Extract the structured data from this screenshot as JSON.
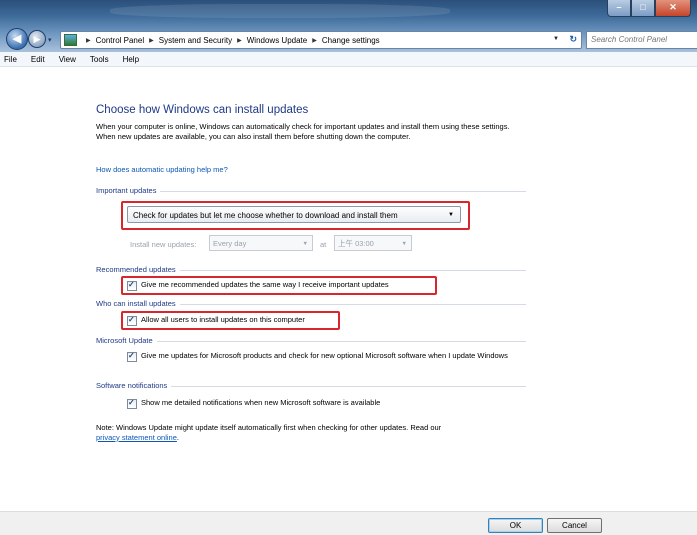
{
  "window": {
    "address_crumbs": [
      "Control Panel",
      "System and Security",
      "Windows Update",
      "Change settings"
    ],
    "search_placeholder": "Search Control Panel",
    "menu": [
      "File",
      "Edit",
      "View",
      "Tools",
      "Help"
    ],
    "icons": [
      "back-arrow-icon",
      "forward-arrow-icon",
      "control-panel-icon",
      "refresh-icon",
      "minimize-icon",
      "maximize-icon",
      "close-icon"
    ]
  },
  "main": {
    "title": "Choose how Windows can install updates",
    "intro": "When your computer is online, Windows can automatically check for important updates and install them using these settings. When new updates are available, you can also install them before shutting down the computer.",
    "help_link": "How does automatic updating help me?",
    "important_updates": {
      "heading": "Important updates",
      "selected": "Check for updates but let me choose whether to download and install them",
      "install_new_label": "Install new updates:",
      "day_value": "Every day",
      "at_label": "at",
      "time_value": "上午 03:00"
    },
    "recommended_updates": {
      "heading": "Recommended updates",
      "checkbox_label": "Give me recommended updates the same way I receive important updates",
      "checked": true
    },
    "who_can_install": {
      "heading": "Who can install updates",
      "checkbox_label": "Allow all users to install updates on this computer",
      "checked": true
    },
    "microsoft_update": {
      "heading": "Microsoft Update",
      "checkbox_label": "Give me updates for Microsoft products and check for new optional Microsoft software when I update Windows",
      "checked": true
    },
    "software_notifications": {
      "heading": "Software notifications",
      "checkbox_label": "Show me detailed notifications when new Microsoft software is available",
      "checked": true
    },
    "note_text": "Note: Windows Update might update itself automatically first when checking for other updates.  Read our",
    "note_link": "privacy statement online",
    "note_end": "."
  },
  "buttons": {
    "ok": "OK",
    "cancel": "Cancel"
  },
  "colors": {
    "heading_blue": "#1e3a87",
    "link_blue": "#0b57b4",
    "highlight_red": "#d7262c"
  }
}
